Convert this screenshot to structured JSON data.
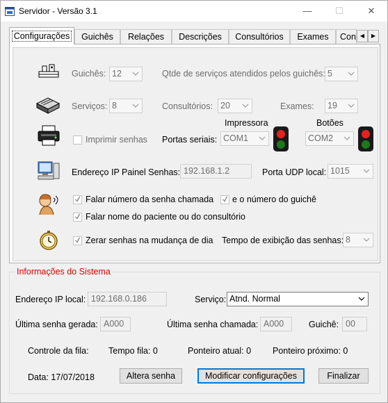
{
  "window": {
    "title": "Servidor - Versão 3.1",
    "minimize": "—",
    "maximize": "☐",
    "close": "✕"
  },
  "tabs": [
    {
      "label": "Configurações",
      "active": true
    },
    {
      "label": "Guichês"
    },
    {
      "label": "Relações"
    },
    {
      "label": "Descrições"
    },
    {
      "label": "Consultórios"
    },
    {
      "label": "Exames"
    },
    {
      "label": "Con"
    }
  ],
  "tab_scroll": {
    "left": "◀",
    "right": "▶"
  },
  "config": {
    "guiches_label": "Guichês:",
    "guiches_value": "12",
    "qtde_label": "Qtde de serviços atendidos pelos guichês:",
    "qtde_value": "5",
    "servicos_label": "Serviços:",
    "servicos_value": "8",
    "consultorios_label": "Consultórios:",
    "consultorios_value": "20",
    "exames_label": "Exames:",
    "exames_value": "19",
    "imprimir_label": "Imprimir senhas",
    "imprimir_checked": false,
    "portas_label": "Portas seriais:",
    "impressora_label": "Impressora",
    "impressora_value": "COM1",
    "botoes_label": "Botões",
    "botoes_value": "COM2",
    "ip_painel_label": "Endereço IP Painel Senhas:",
    "ip_painel_value": "192.168.1.2",
    "porta_udp_label": "Porta UDP local:",
    "porta_udp_value": "1015",
    "falar_numero_label": "Falar número da senha chamada",
    "falar_numero_checked": true,
    "numero_guiche_label": "e o número do guichê",
    "numero_guiche_checked": true,
    "falar_nome_label": "Falar nome do paciente ou do consultório",
    "falar_nome_checked": true,
    "zerar_label": "Zerar senhas na mudança de dia",
    "zerar_checked": true,
    "tempo_exibicao_label": "Tempo de exibição das senhas:",
    "tempo_exibicao_value": "8"
  },
  "info": {
    "legend": "Informações do Sistema",
    "ip_local_label": "Endereço IP local:",
    "ip_local_value": "192.168.0.186",
    "servico_label": "Serviço:",
    "servico_value": "Atnd. Normal",
    "ultima_gerada_label": "Última senha gerada:",
    "ultima_gerada_value": "A000",
    "ultima_chamada_label": "Última senha chamada:",
    "ultima_chamada_value": "A000",
    "guiche_label": "Guichê:",
    "guiche_value": "00",
    "controle_label": "Controle da fila:",
    "tempo_fila": "Tempo fila: 0",
    "ponteiro_atual": "Ponteiro atual: 0",
    "ponteiro_proximo": "Ponteiro próximo: 0",
    "data": "Data: 17/07/2018"
  },
  "buttons": {
    "altera_senha": "Altera senha",
    "modificar": "Modificar configurações",
    "finalizar": "Finalizar"
  },
  "colors": {
    "legend": "#e00000",
    "default_button_border": "#0078d7",
    "light_red": "#e62020",
    "light_green": "#1b7a1b"
  }
}
